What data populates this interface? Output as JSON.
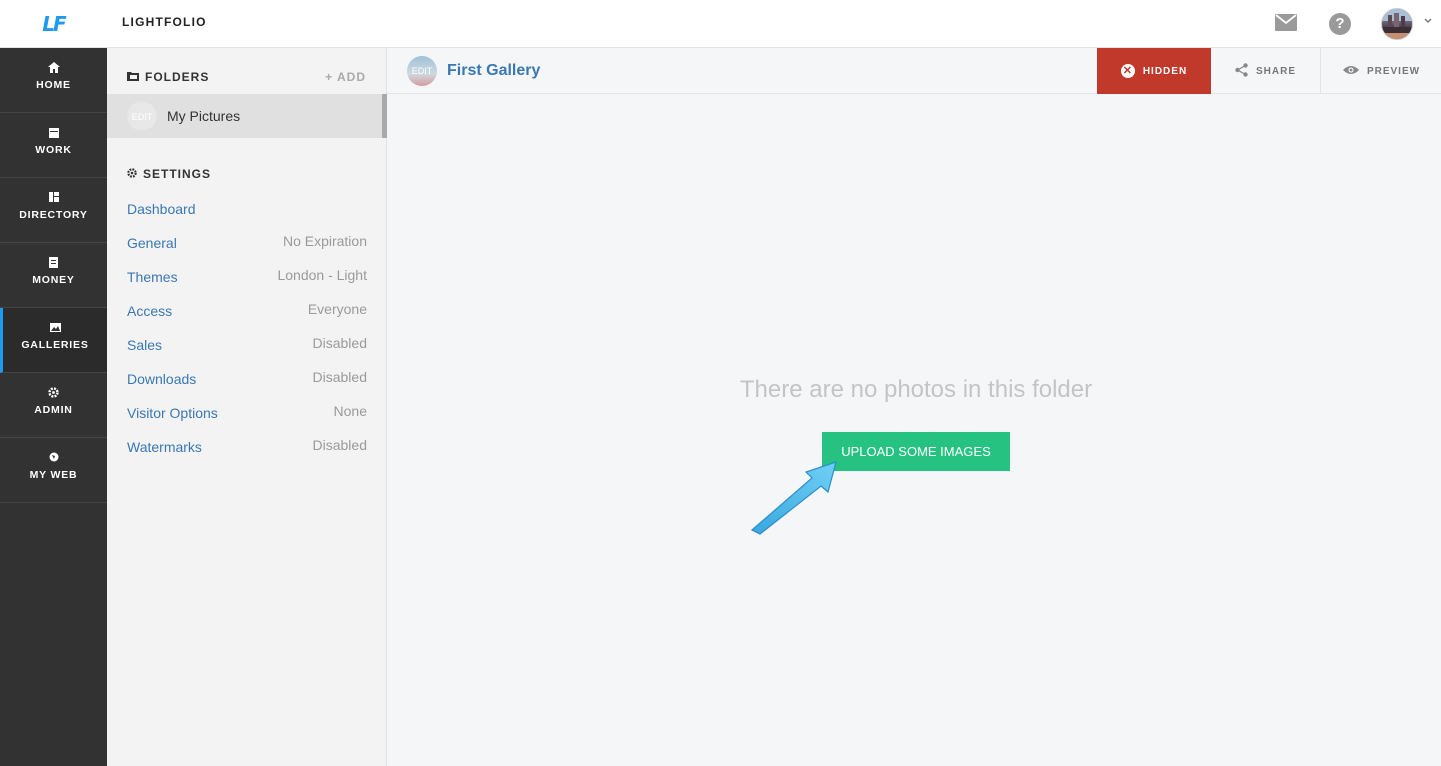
{
  "app": {
    "logo": "LF",
    "name": "LIGHTFOLIO"
  },
  "topbar": {
    "mail_icon": "mail-icon",
    "help_icon": "help-icon",
    "help_glyph": "?",
    "avatar": "avatar",
    "caret_glyph": "⌄"
  },
  "nav": {
    "items": [
      {
        "label": "HOME",
        "icon": "home-icon"
      },
      {
        "label": "WORK",
        "icon": "calendar-icon"
      },
      {
        "label": "DIRECTORY",
        "icon": "directory-icon"
      },
      {
        "label": "MONEY",
        "icon": "money-icon"
      },
      {
        "label": "GALLERIES",
        "icon": "galleries-icon"
      },
      {
        "label": "ADMIN",
        "icon": "gear-icon"
      },
      {
        "label": "MY WEB",
        "icon": "globe-icon"
      }
    ],
    "active": "GALLERIES",
    "active_color": "#1e9bf0"
  },
  "folders": {
    "heading": "FOLDERS",
    "add_label": "+ ADD",
    "items": [
      {
        "name": "My Pictures",
        "thumb_text": "EDIT"
      }
    ]
  },
  "settings": {
    "heading": "SETTINGS",
    "items": [
      {
        "label": "Dashboard",
        "value": ""
      },
      {
        "label": "General",
        "value": "No Expiration"
      },
      {
        "label": "Themes",
        "value": "London - Light"
      },
      {
        "label": "Access",
        "value": "Everyone"
      },
      {
        "label": "Sales",
        "value": "Disabled"
      },
      {
        "label": "Downloads",
        "value": "Disabled"
      },
      {
        "label": "Visitor Options",
        "value": "None"
      },
      {
        "label": "Watermarks",
        "value": "Disabled"
      }
    ]
  },
  "gallery": {
    "title": "First Gallery",
    "thumb_text": "EDIT",
    "actions": {
      "hidden": "HIDDEN",
      "share": "SHARE",
      "preview": "PREVIEW"
    },
    "hidden_color": "#c0392b"
  },
  "empty_state": {
    "message": "There are no photos in this folder",
    "upload_label": "UPLOAD SOME IMAGES",
    "upload_color": "#26c281"
  }
}
